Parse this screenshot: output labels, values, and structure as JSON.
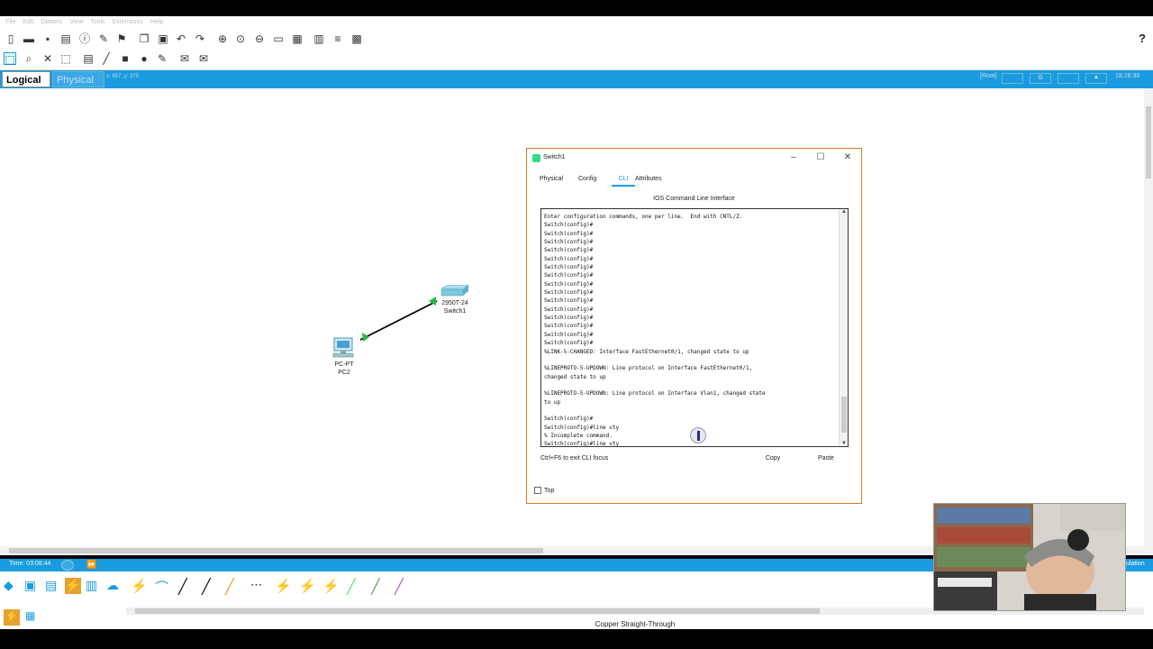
{
  "menu": [
    "File",
    "Edit",
    "Options",
    "View",
    "Tools",
    "Extensions",
    "Help"
  ],
  "workspace": {
    "logical_label": "Logical",
    "physical_label": "Physical",
    "coords": "x: 857, y: 375",
    "root_label": "[Root]",
    "clock": "18:28:30"
  },
  "devices": {
    "switch_model": "2950T-24",
    "switch_name": "Switch1",
    "pc_model": "PC-PT",
    "pc_name": "PC2"
  },
  "window": {
    "title": "Switch1",
    "tabs": [
      "Physical",
      "Config",
      "CLI",
      "Attributes"
    ],
    "active_tab": "CLI",
    "cli_title": "IOS Command Line Interface",
    "terminal_lines": [
      "Enter configuration commands, one per line.  End with CNTL/Z.",
      "Switch(config)#",
      "Switch(config)#",
      "Switch(config)#",
      "Switch(config)#",
      "Switch(config)#",
      "Switch(config)#",
      "Switch(config)#",
      "Switch(config)#",
      "Switch(config)#",
      "Switch(config)#",
      "Switch(config)#",
      "Switch(config)#",
      "Switch(config)#",
      "Switch(config)#",
      "Switch(config)#",
      "%LINK-5-CHANGED: Interface FastEthernet0/1, changed state to up",
      "",
      "%LINEPROTO-5-UPDOWN: Line protocol on Interface FastEthernet0/1,",
      "changed state to up",
      "",
      "%LINEPROTO-5-UPDOWN: Line protocol on Interface Vlan1, changed state",
      "to up",
      "",
      "Switch(config)#",
      "Switch(config)#line vty",
      "% Incomplete command.",
      "Switch(config)#line vty"
    ],
    "focus_hint": "Ctrl+F6 to exit CLI focus",
    "copy_label": "Copy",
    "paste_label": "Paste",
    "top_label": "Top"
  },
  "status": {
    "time": "Time: 03:08:44",
    "connection_type": "Copper Straight-Through",
    "simulation_label": "ulation"
  },
  "colors": {
    "accent": "#1a9be0",
    "window_border": "#e07a1f",
    "link_up": "#22bb44"
  }
}
